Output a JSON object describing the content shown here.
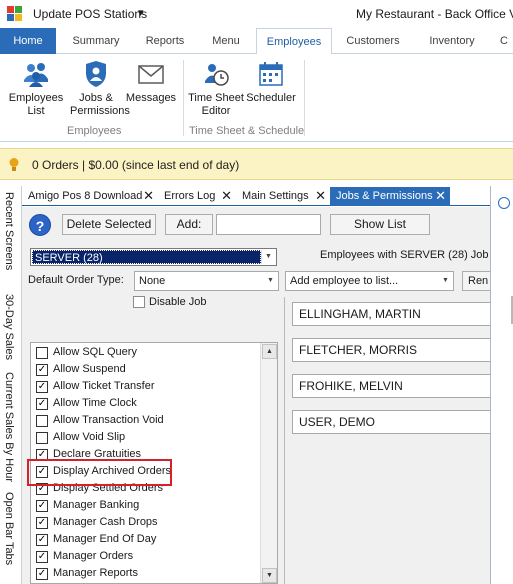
{
  "titlebar": {
    "quick_access": "Update POS Stations",
    "quick_access_dropdown": "▾",
    "window_title": "My Restaurant - Back Office Ver"
  },
  "ribbon_tabs": {
    "home": "Home",
    "summary": "Summary",
    "reports": "Reports",
    "menu": "Menu",
    "employees": "Employees",
    "customers": "Customers",
    "inventory": "Inventory",
    "cutoff": "C"
  },
  "ribbon": {
    "employees_list_1": "Employees",
    "employees_list_2": "List",
    "jobs_1": "Jobs &",
    "jobs_2": "Permissions",
    "messages": "Messages",
    "group_employees": "Employees",
    "timesheet_1": "Time Sheet",
    "timesheet_2": "Editor",
    "scheduler": "Scheduler",
    "group_timesheet": "Time Sheet & Schedule"
  },
  "notification": {
    "text": "0 Orders | $0.00 (since last end of day)"
  },
  "side_tabs": {
    "recent": "Recent Screens",
    "sales30": "30-Day Sales",
    "hourly": "Current Sales By Hour",
    "openbar": "Open Bar Tabs"
  },
  "doc_tabs": {
    "amigo": "Amigo Pos 8 Download",
    "errors": "Errors Log",
    "main_settings": "Main Settings",
    "jobs": "Jobs & Permissions",
    "close_glyph": "✕"
  },
  "toolbar": {
    "help": "?",
    "delete_selected": "Delete Selected",
    "add_label": "Add:",
    "add_value": "",
    "show_list": "Show List"
  },
  "job_select": {
    "value": "SERVER (28)",
    "arrow": "▼"
  },
  "employees_header": "Employees with SERVER (28) Job",
  "default_order": {
    "label": "Default Order Type:",
    "value": "None"
  },
  "add_employee": {
    "placeholder": "Add employee to list...",
    "remove_btn": "Ren"
  },
  "disable_job": {
    "label": "Disable Job",
    "checked": false
  },
  "check_glyph": "✓",
  "scroll": {
    "up": "▲",
    "down": "▼"
  },
  "permissions": [
    {
      "label": "Allow SQL Query",
      "checked": false
    },
    {
      "label": "Allow Suspend",
      "checked": true
    },
    {
      "label": "Allow Ticket Transfer",
      "checked": true
    },
    {
      "label": "Allow Time Clock",
      "checked": true
    },
    {
      "label": "Allow Transaction Void",
      "checked": false
    },
    {
      "label": "Allow Void Slip",
      "checked": false
    },
    {
      "label": "Declare Gratuities",
      "checked": true
    },
    {
      "label": "Display Archived Orders",
      "checked": true
    },
    {
      "label": "Display Settled Orders",
      "checked": true
    },
    {
      "label": "Manager Banking",
      "checked": true
    },
    {
      "label": "Manager Cash Drops",
      "checked": true
    },
    {
      "label": "Manager End Of Day",
      "checked": true
    },
    {
      "label": "Manager Orders",
      "checked": true
    },
    {
      "label": "Manager Reports",
      "checked": true
    }
  ],
  "employees": [
    "ELLINGHAM, MARTIN",
    "FLETCHER, MORRIS",
    "FROHIKE, MELVIN",
    "USER, DEMO"
  ],
  "colors": {
    "accent": "#2b6cb8",
    "notify_bg": "#fbf3c4",
    "highlight": "#d3222a",
    "selection": "#0a246a"
  }
}
